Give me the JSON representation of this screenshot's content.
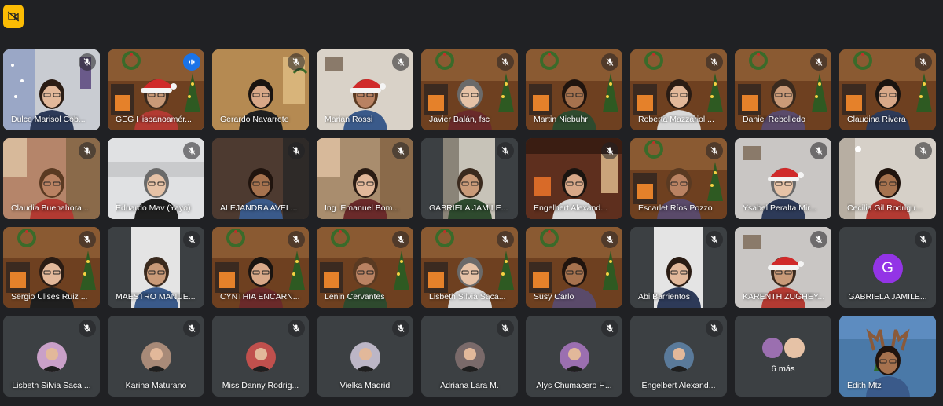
{
  "toolbar": {
    "camera_off_icon": "video-off-icon",
    "color": "#fbbc04"
  },
  "grid": {
    "tiles": [
      {
        "name": "Dulce Marisol Cob...",
        "bg": "#c7c9cc",
        "scene": "winter",
        "muted": true
      },
      {
        "name": "GEG Hispanoamér...",
        "bg": "#9b6b3b",
        "scene": "fireplace-santa",
        "muted": false,
        "speaking": true
      },
      {
        "name": "Gerardo Navarrete",
        "bg": "#b6894e",
        "scene": "office",
        "muted": true
      },
      {
        "name": "Marian Rossi",
        "bg": "#d9d2c8",
        "scene": "santa",
        "muted": true
      },
      {
        "name": "Javier Balán, fsc",
        "bg": "#7b4a25",
        "scene": "fireplace",
        "muted": true
      },
      {
        "name": "Martin Niebuhr",
        "bg": "#7b4a25",
        "scene": "fireplace",
        "muted": true
      },
      {
        "name": "Roberta Mazzariol ...",
        "bg": "#7b4a25",
        "scene": "fireplace",
        "muted": true
      },
      {
        "name": "Daniel Rebolledo",
        "bg": "#7b4a25",
        "scene": "fireplace",
        "muted": true
      },
      {
        "name": "Claudina Rivera",
        "bg": "#7b4a25",
        "scene": "fireplace",
        "muted": true
      },
      {
        "name": "Claudia Buenahora...",
        "bg": "#b5856a",
        "scene": "room",
        "muted": true
      },
      {
        "name": "Eduardo Mav (Yayo)",
        "bg": "#d8d9db",
        "scene": "office-light",
        "muted": true
      },
      {
        "name": "ALEJANDRA AVEL...",
        "bg": "#5b4a3f",
        "scene": "close",
        "muted": true
      },
      {
        "name": "Ing. Emanuel Bom...",
        "bg": "#a98d6e",
        "scene": "room",
        "muted": true
      },
      {
        "name": "GABRIELA JAMILE...",
        "bg": "#55585c",
        "scene": "narrow",
        "muted": true
      },
      {
        "name": "Engelbert Alexand...",
        "bg": "#6b3826",
        "scene": "warm-room",
        "muted": true
      },
      {
        "name": "Escarlet Ríos Pozzo",
        "bg": "#7b4a25",
        "scene": "fireplace",
        "muted": true
      },
      {
        "name": "Ysabel Peralta Mir...",
        "bg": "#c9c6c4",
        "scene": "santa",
        "muted": true
      },
      {
        "name": "Cecilia Gil Rodrigu...",
        "bg": "#d8d3cc",
        "scene": "room-light",
        "muted": true
      },
      {
        "name": "Sergio Ulises Ruiz ...",
        "bg": "#7b4a25",
        "scene": "fireplace",
        "muted": true
      },
      {
        "name": "MAESTRO MANUE...",
        "bg": "#3c4043",
        "scene": "narrow-light",
        "muted": true
      },
      {
        "name": "CYNTHIA ENCARN...",
        "bg": "#7b4a25",
        "scene": "fireplace",
        "muted": true
      },
      {
        "name": "Lenin Cervantes",
        "bg": "#7b4a25",
        "scene": "fireplace",
        "muted": true
      },
      {
        "name": "Lisbeth Silvia Saca...",
        "bg": "#7b4a25",
        "scene": "fireplace",
        "muted": true
      },
      {
        "name": "Susy Carlo",
        "bg": "#7b4a25",
        "scene": "fireplace",
        "muted": true
      },
      {
        "name": "Abi Barrientos",
        "bg": "#3c4043",
        "scene": "narrow-light",
        "muted": true
      },
      {
        "name": "KARENTH ZUGHEY...",
        "bg": "#c9c6c4",
        "scene": "santa",
        "muted": true
      },
      {
        "name": "GABRIELA JAMILE...",
        "bg": "#3c4043",
        "scene": "letter",
        "letter": "G",
        "muted": true
      },
      {
        "name": "Lisbeth Silvia Saca ...",
        "bg": "#3c4043",
        "scene": "avatar",
        "avatar_color": "#c9a0c8",
        "muted": true
      },
      {
        "name": "Karina Maturano",
        "bg": "#3c4043",
        "scene": "avatar",
        "avatar_color": "#a88a78",
        "muted": true
      },
      {
        "name": "Miss Danny Rodrig...",
        "bg": "#3c4043",
        "scene": "avatar",
        "avatar_color": "#c0504d",
        "muted": true
      },
      {
        "name": "Vielka Madrid",
        "bg": "#3c4043",
        "scene": "avatar",
        "avatar_color": "#bcb6c6",
        "muted": true
      },
      {
        "name": "Adriana Lara M.",
        "bg": "#3c4043",
        "scene": "avatar",
        "avatar_color": "#7a6a6a",
        "muted": true
      },
      {
        "name": "Alys Chumacero H...",
        "bg": "#3c4043",
        "scene": "avatar",
        "avatar_color": "#9b6fb0",
        "muted": true
      },
      {
        "name": "Engelbert Alexand...",
        "bg": "#3c4043",
        "scene": "avatar",
        "avatar_color": "#5a7a9a",
        "muted": true
      },
      {
        "name": "",
        "bg": "#3c4043",
        "scene": "more",
        "more_label": "6 más",
        "muted": false
      },
      {
        "name": "Edith Mtz",
        "bg": "#4a79a8",
        "scene": "reindeer",
        "muted": false
      }
    ]
  }
}
